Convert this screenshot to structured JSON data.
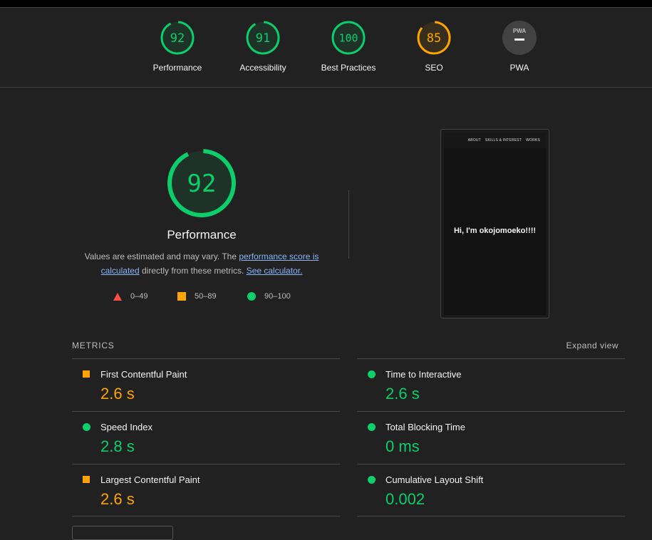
{
  "summary": {
    "categories": [
      {
        "label": "Performance",
        "score": "92",
        "value": 0.92,
        "status": "pass"
      },
      {
        "label": "Accessibility",
        "score": "91",
        "value": 0.91,
        "status": "pass"
      },
      {
        "label": "Best Practices",
        "score": "100",
        "value": 1.0,
        "status": "pass"
      },
      {
        "label": "SEO",
        "score": "85",
        "value": 0.85,
        "status": "average"
      },
      {
        "label": "PWA",
        "score": "",
        "value": null,
        "status": "na",
        "badge_text": "PWA"
      }
    ]
  },
  "colors": {
    "pass": "#0cce6b",
    "average": "#ffa400",
    "fail": "#ff4e42",
    "na": "#424242",
    "link": "#8ab4f8"
  },
  "performance": {
    "score": "92",
    "value": 0.92,
    "title": "Performance",
    "desc_prefix": "Values are estimated and may vary. The ",
    "desc_link1": "performance score is calculated",
    "desc_middle": " directly from these metrics. ",
    "desc_link2": "See calculator.",
    "legend": [
      {
        "icon": "triangle-icon",
        "range": "0–49"
      },
      {
        "icon": "square-icon",
        "range": "50–89"
      },
      {
        "icon": "circle-icon",
        "range": "90–100"
      }
    ]
  },
  "screenshot": {
    "nav_items": [
      "ABOUT",
      "SKILLS & INTEREST",
      "WORKS"
    ],
    "hero_text": "Hi, I'm okojomoeko!!!!"
  },
  "metrics": {
    "heading": "METRICS",
    "expand_label": "Expand view",
    "items": [
      {
        "name": "First Contentful Paint",
        "value": "2.6 s",
        "status": "average"
      },
      {
        "name": "Time to Interactive",
        "value": "2.6 s",
        "status": "pass"
      },
      {
        "name": "Speed Index",
        "value": "2.8 s",
        "status": "pass"
      },
      {
        "name": "Total Blocking Time",
        "value": "0 ms",
        "status": "pass"
      },
      {
        "name": "Largest Contentful Paint",
        "value": "2.6 s",
        "status": "average"
      },
      {
        "name": "Cumulative Layout Shift",
        "value": "0.002",
        "status": "pass"
      }
    ]
  }
}
